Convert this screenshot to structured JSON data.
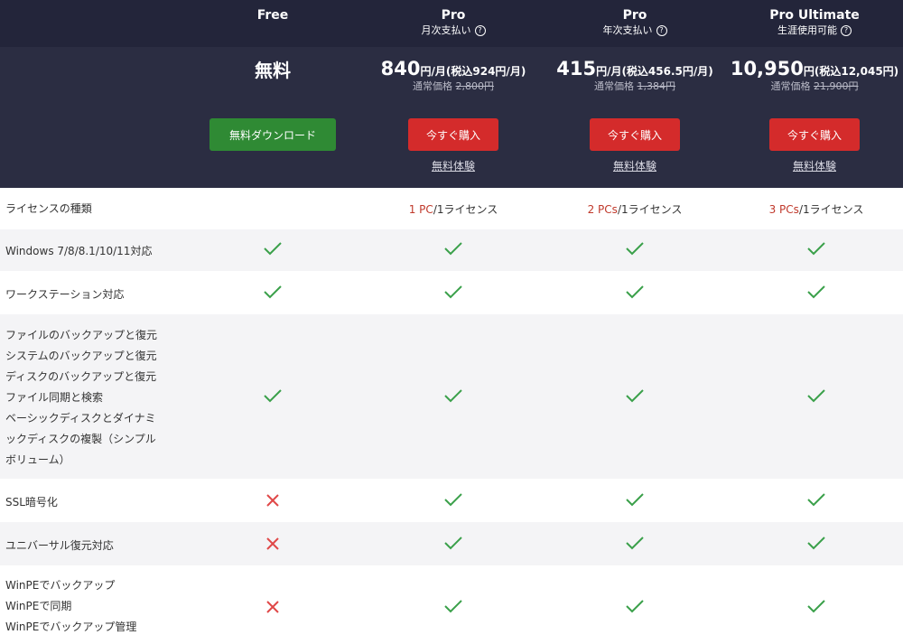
{
  "plans": [
    {
      "name": "Free",
      "sub": "",
      "price_big": "無料",
      "price_small": "",
      "regular_label": "",
      "regular_price": "",
      "button": "無料ダウンロード",
      "trial": ""
    },
    {
      "name": "Pro",
      "sub": "月次支払い",
      "price_big": "840",
      "price_small": "円/月(税込924円/月)",
      "regular_label": "通常価格",
      "regular_price": "2,800円",
      "button": "今すぐ購入",
      "trial": "無料体験"
    },
    {
      "name": "Pro",
      "sub": "年次支払い",
      "price_big": "415",
      "price_small": "円/月(税込456.5円/月)",
      "regular_label": "通常価格",
      "regular_price": "1,384円",
      "button": "今すぐ購入",
      "trial": "無料体験"
    },
    {
      "name": "Pro Ultimate",
      "sub": "生涯使用可能",
      "price_big": "10,950",
      "price_small": "円(税込12,045円)",
      "regular_label": "通常価格",
      "regular_price": "21,900円",
      "button": "今すぐ購入",
      "trial": "無料体験"
    }
  ],
  "rows": {
    "license": {
      "label": "ライセンスの種類",
      "cells": [
        {
          "count": "",
          "text": ""
        },
        {
          "count": "1 PC",
          "text": "/1ライセンス"
        },
        {
          "count": "2 PCs",
          "text": "/1ライセンス"
        },
        {
          "count": "3 PCs",
          "text": "/1ライセンス"
        }
      ]
    },
    "windows": {
      "label": "Windows 7/8/8.1/10/11対応"
    },
    "workstation": {
      "label": "ワークステーション対応"
    },
    "features": {
      "lines": [
        "ファイルのバックアップと復元",
        "システムのバックアップと復元",
        "ディスクのバックアップと復元",
        "ファイル同期と検索",
        "ベーシックディスクとダイナミ",
        "ックディスクの複製（シンプル",
        "ボリューム）"
      ]
    },
    "ssl": {
      "label": "SSL暗号化"
    },
    "universal": {
      "label": "ユニバーサル復元対応"
    },
    "winpe": {
      "lines": [
        "WinPEでバックアップ",
        "WinPEで同期",
        "WinPEでバックアップ管理"
      ]
    }
  },
  "colors": {
    "header_bg": "#2b2d42",
    "check": "#3aa04a",
    "cross": "#e04848",
    "buy": "#d42b2b",
    "free": "#2f8a34"
  }
}
